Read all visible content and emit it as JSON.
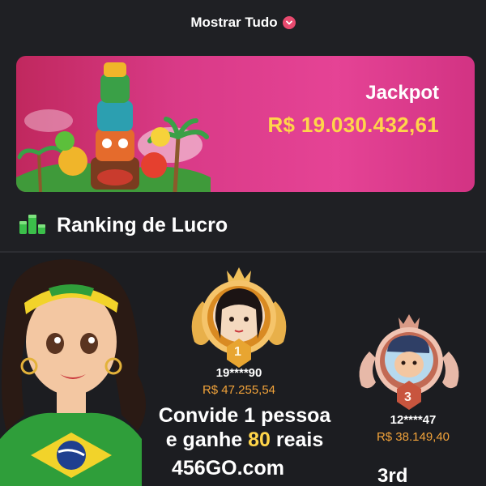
{
  "header": {
    "show_all_label": "Mostrar Tudo"
  },
  "jackpot": {
    "label": "Jackpot",
    "value": "R$ 19.030.432,61"
  },
  "ranking": {
    "title": "Ranking de Lucro",
    "first": {
      "rank": "1",
      "name": "19****90",
      "amount": "R$ 47.255,54"
    },
    "second": {
      "rank": "3",
      "name": "12****47",
      "amount": "R$ 38.149,40",
      "place_label": "3rd"
    }
  },
  "promo": {
    "line1": "Convide 1 pessoa",
    "line2_prefix": "e ganhe ",
    "line2_highlight": "80",
    "line2_suffix": " reais",
    "site": "456GO.com"
  },
  "colors": {
    "accent": "#e84a6f",
    "gold": "#ffd54a",
    "amount": "#f2a33a",
    "banner": "#d93a87"
  }
}
